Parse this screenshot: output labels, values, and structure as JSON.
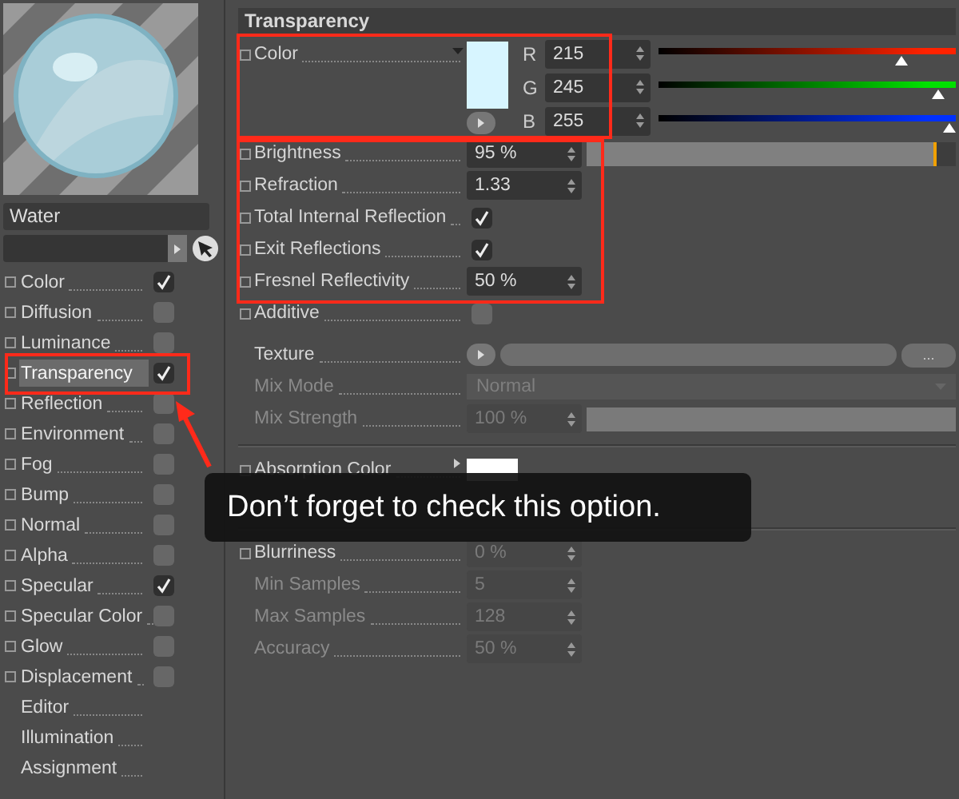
{
  "sidebar": {
    "material_name": "Water",
    "channels": [
      {
        "label": "Color",
        "kind": "checkbox",
        "checked": true,
        "selected": false
      },
      {
        "label": "Diffusion",
        "kind": "checkbox",
        "checked": false,
        "selected": false
      },
      {
        "label": "Luminance",
        "kind": "checkbox",
        "checked": false,
        "selected": false
      },
      {
        "label": "Transparency",
        "kind": "checkbox",
        "checked": true,
        "selected": true
      },
      {
        "label": "Reflection",
        "kind": "checkbox",
        "checked": false,
        "selected": false
      },
      {
        "label": "Environment",
        "kind": "checkbox",
        "checked": false,
        "selected": false
      },
      {
        "label": "Fog",
        "kind": "checkbox",
        "checked": false,
        "selected": false
      },
      {
        "label": "Bump",
        "kind": "checkbox",
        "checked": false,
        "selected": false
      },
      {
        "label": "Normal",
        "kind": "checkbox",
        "checked": false,
        "selected": false
      },
      {
        "label": "Alpha",
        "kind": "checkbox",
        "checked": false,
        "selected": false
      },
      {
        "label": "Specular",
        "kind": "checkbox",
        "checked": true,
        "selected": false
      },
      {
        "label": "Specular Color",
        "kind": "checkbox",
        "checked": false,
        "selected": false
      },
      {
        "label": "Glow",
        "kind": "checkbox",
        "checked": false,
        "selected": false
      },
      {
        "label": "Displacement",
        "kind": "checkbox",
        "checked": false,
        "selected": false
      },
      {
        "label": "Editor",
        "kind": "plain",
        "selected": false
      },
      {
        "label": "Illumination",
        "kind": "plain",
        "selected": false
      },
      {
        "label": "Assignment",
        "kind": "plain",
        "selected": false
      }
    ]
  },
  "panel": {
    "title": "Transparency",
    "params": [
      {
        "kind": "color",
        "label": "Color",
        "keyframe": true,
        "disabled": false,
        "components": [
          {
            "channel": "R",
            "value": "215",
            "level": 0.84,
            "color": "#ff2200"
          },
          {
            "channel": "G",
            "value": "245",
            "level": 0.96,
            "color": "#00e000"
          },
          {
            "channel": "B",
            "value": "255",
            "level": 1,
            "color": "#0030ff"
          }
        ]
      },
      {
        "kind": "slider",
        "label": "Brightness",
        "keyframe": true,
        "disabled": false,
        "value": "95 %",
        "level": 0.95
      },
      {
        "kind": "number",
        "label": "Refraction",
        "keyframe": true,
        "disabled": false,
        "value": "1.33"
      },
      {
        "kind": "checkbox",
        "label": "Total Internal Reflection",
        "keyframe": true,
        "disabled": false,
        "checked": true
      },
      {
        "kind": "checkbox",
        "label": "Exit Reflections",
        "keyframe": true,
        "disabled": false,
        "checked": true
      },
      {
        "kind": "number",
        "label": "Fresnel Reflectivity",
        "keyframe": true,
        "disabled": false,
        "value": "50 %"
      },
      {
        "kind": "checkbox",
        "label": "Additive",
        "keyframe": true,
        "disabled": false,
        "checked": false
      },
      {
        "kind": "texture",
        "label": "Texture",
        "keyframe": false,
        "disabled": false,
        "button": "..."
      },
      {
        "kind": "dropdown",
        "label": "Mix Mode",
        "keyframe": false,
        "disabled": true,
        "value": "Normal"
      },
      {
        "kind": "slider",
        "label": "Mix Strength",
        "keyframe": false,
        "disabled": true,
        "value": "100 %",
        "level": 1
      },
      {
        "kind": "separator"
      },
      {
        "kind": "swatch",
        "label": "Absorption Color",
        "keyframe": true,
        "disabled": false,
        "color": "#ffffff"
      },
      {
        "kind": "separator"
      },
      {
        "kind": "number",
        "label": "Blurriness",
        "keyframe": true,
        "disabled": false,
        "value": "0 %",
        "value_disabled": true
      },
      {
        "kind": "number",
        "label": "Min Samples",
        "keyframe": false,
        "disabled": true,
        "value": "5"
      },
      {
        "kind": "number",
        "label": "Max Samples",
        "keyframe": false,
        "disabled": true,
        "value": "128"
      },
      {
        "kind": "number",
        "label": "Accuracy",
        "keyframe": false,
        "disabled": true,
        "value": "50 %"
      }
    ]
  },
  "callout": "Don’t forget to check this option."
}
